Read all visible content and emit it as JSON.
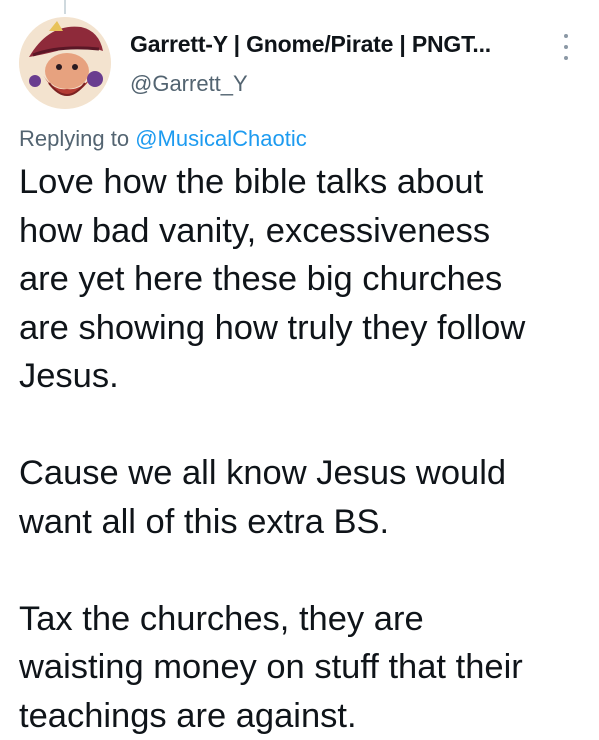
{
  "author": {
    "display_name": "Garrett-Y | Gnome/Pirate | PNGT...",
    "handle": "@Garrett_Y",
    "avatar_icon": "gnome-pirate-avatar"
  },
  "reply": {
    "prefix": "Replying to",
    "target": "@MusicalChaotic"
  },
  "tweet": {
    "paragraphs": [
      {
        "lines": [
          "Love how the bible talks about",
          "how bad vanity, excessiveness",
          "are yet here these big churches",
          "are showing how truly they follow",
          "Jesus."
        ]
      },
      {
        "lines": [
          "Cause we all know Jesus would",
          "want all of this extra BS."
        ]
      },
      {
        "lines": [
          "Tax the churches, they are",
          "waisting money on stuff that their",
          "teachings are against."
        ]
      }
    ]
  },
  "colors": {
    "text": "#0f1419",
    "muted": "#536471",
    "link": "#1d9bf0"
  }
}
